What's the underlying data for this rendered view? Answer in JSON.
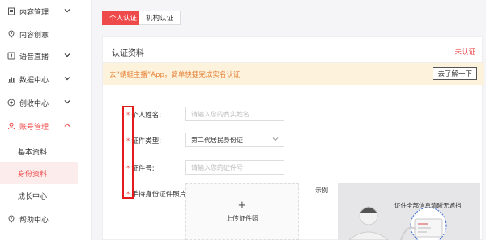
{
  "sidebar": {
    "items": [
      {
        "label": "内容管理",
        "icon": "document-icon",
        "has_chevron": true,
        "chevron": "down"
      },
      {
        "label": "内容创意",
        "icon": "location-pin-icon",
        "has_chevron": false
      },
      {
        "label": "语音直播",
        "icon": "microphone-box-icon",
        "has_chevron": true,
        "chevron": "down"
      },
      {
        "label": "数据中心",
        "icon": "bar-chart-icon",
        "has_chevron": true,
        "chevron": "down"
      },
      {
        "label": "创收中心",
        "icon": "coin-icon",
        "has_chevron": true,
        "chevron": "down"
      },
      {
        "label": "账号管理",
        "icon": "user-icon",
        "has_chevron": true,
        "chevron": "up",
        "active": true
      }
    ],
    "sub_items": [
      {
        "label": "基本资料",
        "selected": false
      },
      {
        "label": "身份资料",
        "selected": true
      },
      {
        "label": "成长中心",
        "selected": false
      }
    ],
    "bottom_item": {
      "label": "帮助中心",
      "icon": "help-icon"
    }
  },
  "tabs": [
    {
      "label": "个人认证",
      "active": true
    },
    {
      "label": "机构认证",
      "active": false
    }
  ],
  "panel": {
    "title": "认证资料",
    "status": "未认证",
    "banner_text": "去“蜻蜓主播”App，简单快捷完成实名认证",
    "banner_button": "去了解一下"
  },
  "form": {
    "name_label": "个人姓名:",
    "name_placeholder": "请输入您的真实姓名",
    "id_type_label": "证件类型:",
    "id_type_value": "第二代居民身份证",
    "id_number_label": "证件号:",
    "id_number_placeholder": "请输入您的证件号",
    "photo_label": "手持身份证件照片:",
    "upload_plus": "+",
    "upload_label": "上传证件照",
    "example_label": "示例",
    "example_caption": "证件全部信息清晰无遮挡",
    "required_mark": "*"
  },
  "colors": {
    "accent": "#ee4a4a",
    "banner_bg": "#fdf3dc",
    "banner_text": "#e6833a",
    "highlight": "#e31b1b"
  }
}
